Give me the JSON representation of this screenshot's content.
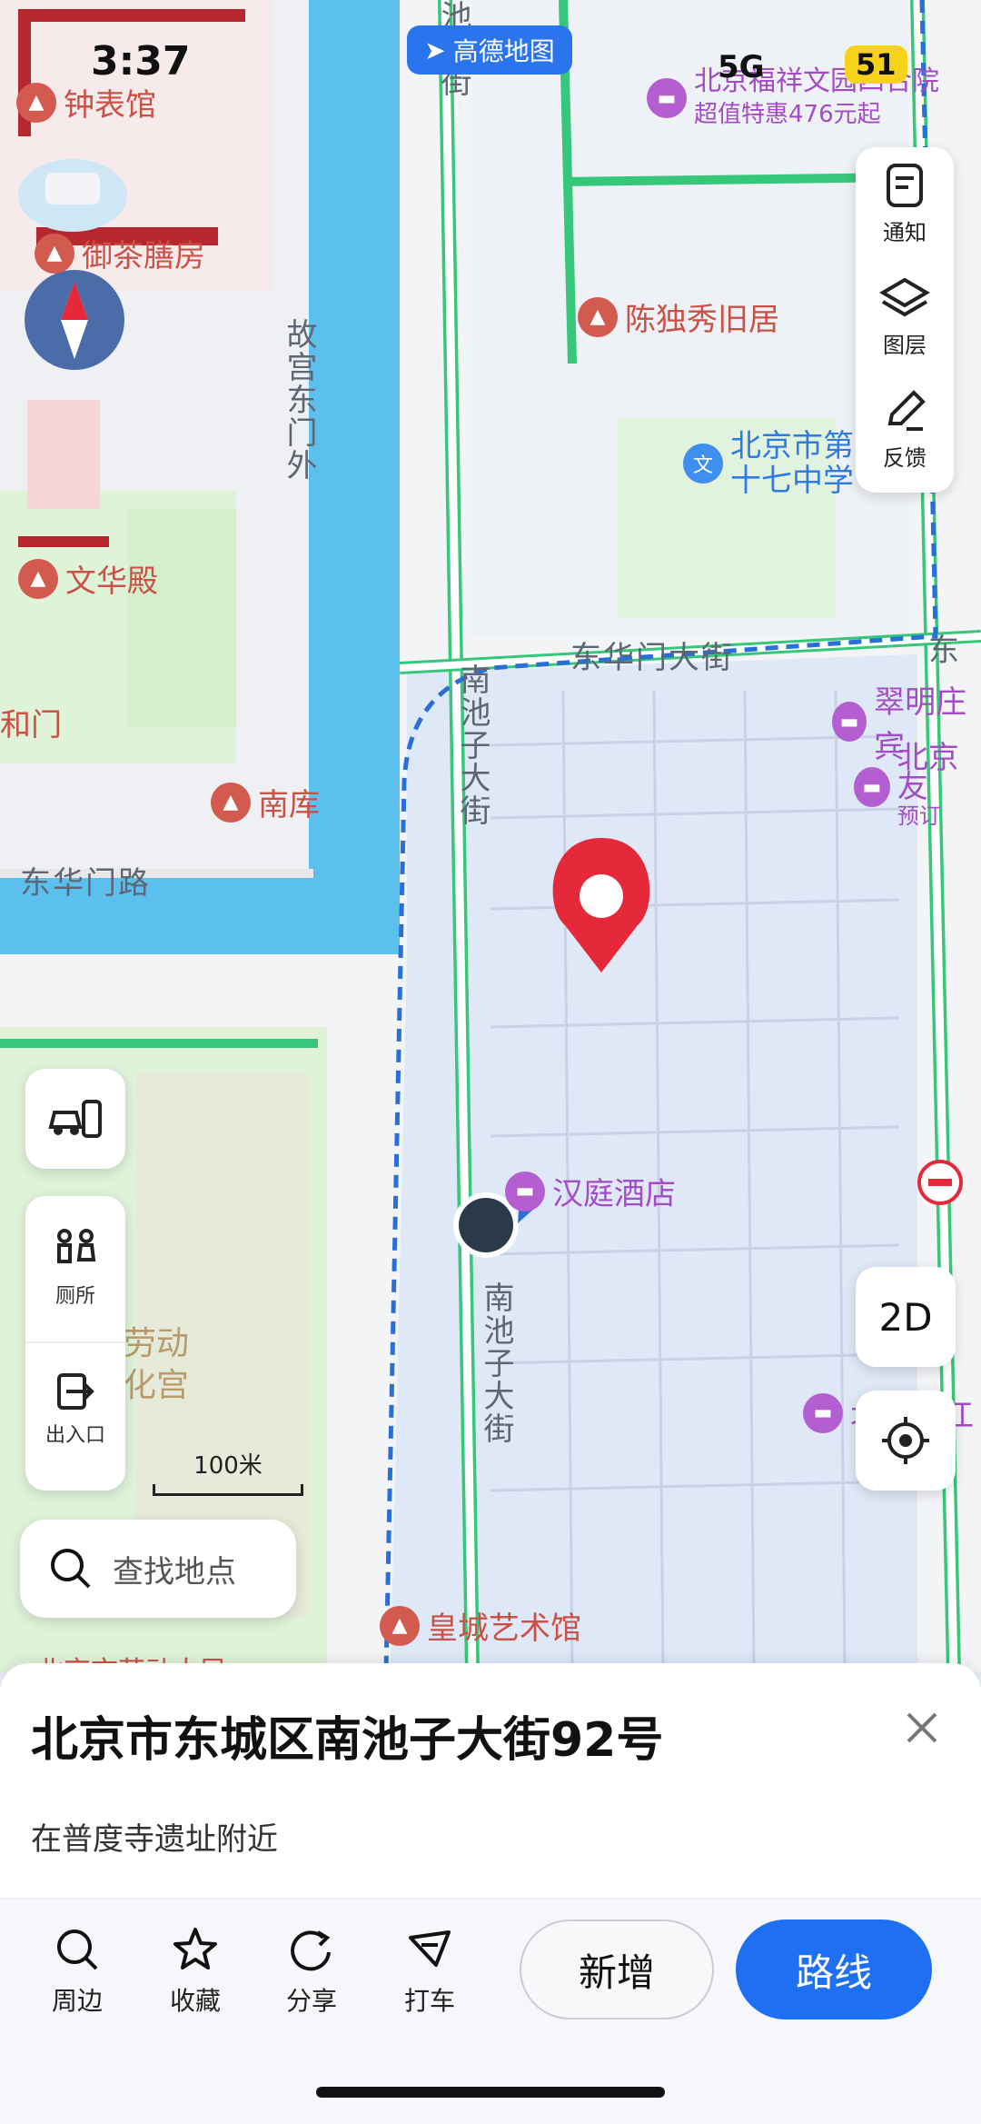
{
  "status": {
    "time": "3:37",
    "app_badge": "高德地图",
    "network": "5G",
    "battery": "51"
  },
  "map": {
    "pois": {
      "zhongbiaoguan": "钟表馆",
      "yuchashanfang": "御茶膳房",
      "wenhuadian": "文华殿",
      "nanku": "南库",
      "chenduxiu": "陈独秀旧居",
      "school": [
        "北京市第",
        "十七中学"
      ],
      "cuimingzhuang": "翠明庄宾",
      "beijingyou": "北京友",
      "yuding": "预订",
      "fuxiang": "北京福祥文园四合院",
      "fuxiang_promo": "超值特惠476元起",
      "hanting": "汉庭酒店",
      "huangcheng": "皇城艺术馆",
      "xiujiang": "北京秀江",
      "laodong": "劳动",
      "renmin": "化宫",
      "hemen": "和门",
      "bottom_cut": "北京市劳动人民"
    },
    "roads": {
      "gugong_dongmenwai": "故宫东门外",
      "donghuamen_dajie": "东华门大街",
      "donghuamen_lu": "东华门路",
      "nanchizi_upper": "南池子大街",
      "nanchizi_lower": "南池子大街",
      "chizi_top": "池大街",
      "dong": "东"
    },
    "scale_label": "100米"
  },
  "right_panel": {
    "notice": "通知",
    "layers": "图层",
    "feedback": "反馈"
  },
  "left_panel": {
    "toilet": "厕所",
    "entrance": "出入口"
  },
  "view_toggle": "2D",
  "search": {
    "placeholder": "查找地点"
  },
  "sheet": {
    "address": "北京市东城区南池子大街92号",
    "nearby": "在普度寺遗址附近",
    "actions": {
      "nearby": "周边",
      "favorite": "收藏",
      "share": "分享",
      "taxi": "打车"
    },
    "add_button": "新增",
    "route_button": "路线"
  },
  "colors": {
    "accent": "#1f6ff2",
    "water": "#5cc0ef",
    "greenline": "#36c77a",
    "route": "#2a6fd8",
    "marker": "#e5283a"
  }
}
